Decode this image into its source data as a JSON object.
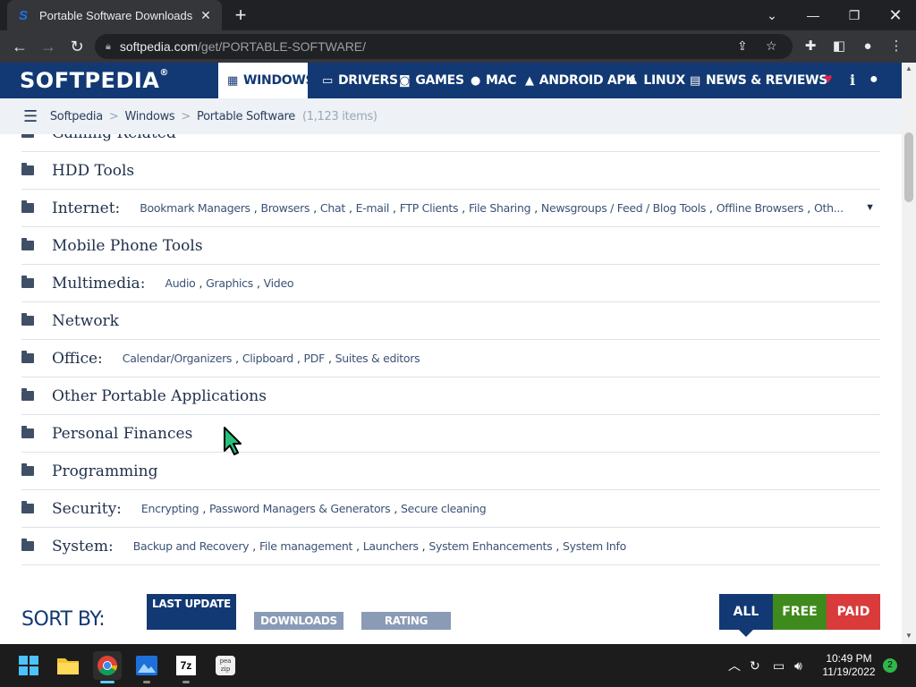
{
  "browser": {
    "tab_title": "Portable Software Downloads",
    "tab_favicon": "S",
    "url_domain": "softpedia.com",
    "url_path": "/get/PORTABLE-SOFTWARE/"
  },
  "header": {
    "logo": "SOFTPEDIA",
    "logo_mark": "®",
    "nav": [
      {
        "label": "WINDOWS",
        "icon": "windows-icon",
        "active": true
      },
      {
        "label": "DRIVERS",
        "icon": "drivers-icon"
      },
      {
        "label": "GAMES",
        "icon": "gamepad-icon"
      },
      {
        "label": "MAC",
        "icon": "apple-icon"
      },
      {
        "label": "ANDROID APK",
        "icon": "android-icon"
      },
      {
        "label": "LINUX",
        "icon": "linux-icon"
      },
      {
        "label": "NEWS & REVIEWS",
        "icon": "news-icon"
      }
    ],
    "accent": "#123973",
    "heart_color": "#e0234e"
  },
  "breadcrumb": {
    "items": [
      "Softpedia",
      "Windows",
      "Portable Software"
    ],
    "count": "(1,123 items)"
  },
  "categories": [
    {
      "name": "Gaming Related",
      "subs": []
    },
    {
      "name": "HDD Tools",
      "subs": []
    },
    {
      "name": "Internet:",
      "subs": [
        "Bookmark Managers",
        "Browsers",
        "Chat",
        "E-mail",
        "FTP Clients",
        "File Sharing",
        "Newsgroups / Feed / Blog Tools",
        "Offline Browsers",
        "Oth..."
      ]
    },
    {
      "name": "Mobile Phone Tools",
      "subs": []
    },
    {
      "name": "Multimedia:",
      "subs": [
        "Audio",
        "Graphics",
        "Video"
      ]
    },
    {
      "name": "Network",
      "subs": []
    },
    {
      "name": "Office:",
      "subs": [
        "Calendar/Organizers",
        "Clipboard",
        "PDF",
        "Suites & editors"
      ]
    },
    {
      "name": "Other Portable Applications",
      "subs": []
    },
    {
      "name": "Personal Finances",
      "subs": []
    },
    {
      "name": "Programming",
      "subs": []
    },
    {
      "name": "Security:",
      "subs": [
        "Encrypting",
        "Password Managers & Generators",
        "Secure cleaning"
      ]
    },
    {
      "name": "System:",
      "subs": [
        "Backup and Recovery",
        "File management",
        "Launchers",
        "System Enhancements",
        "System Info"
      ]
    }
  ],
  "sort": {
    "label": "SORT BY:",
    "options": [
      "LAST UPDATE",
      "DOWNLOADS",
      "RATING"
    ],
    "filters": [
      "ALL",
      "FREE",
      "PAID"
    ],
    "filter_colors": [
      "#123973",
      "#3f8a1c",
      "#d93a3a"
    ]
  },
  "taskbar": {
    "apps": [
      "windows-start-icon",
      "file-explorer-icon",
      "chrome-icon",
      "photos-icon",
      "7zip-icon",
      "peazip-icon"
    ],
    "app_labels": {
      "7zip": "7z",
      "peazip": "pea zip"
    },
    "time": "10:49 PM",
    "date": "11/19/2022",
    "notifications": "2"
  }
}
